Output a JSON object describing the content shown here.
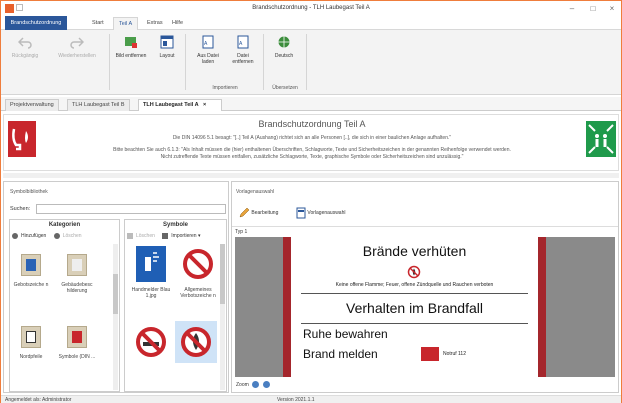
{
  "window": {
    "title": "Brandschutzordnung - TLH Laubegast Teil A",
    "controls": [
      "–",
      "□",
      "×"
    ]
  },
  "ribbon_tabs": [
    "Brandschutzordnung",
    "Start",
    "Teil A",
    "Extras",
    "Hilfe"
  ],
  "ribbon": {
    "back_label": "Rückgängig",
    "forward_label": "Wiederherstellen",
    "bild_label": "Bild entfernen",
    "layout_label": "Layout",
    "aus_datei_label": "Aus Datei laden",
    "datei_entfernen_label": "Datei entfernen",
    "deutsch_label": "Deutsch",
    "group_importieren": "Importieren",
    "group_uebersetzen": "Übersetzen"
  },
  "doc_tabs": [
    "Projektverwaltung",
    "TLH Laubegast Teil B",
    "TLH Laubegast Teil A"
  ],
  "doc_tab_close": "×",
  "header": {
    "title": "Brandschutzordnung Teil A",
    "line1": "Die DIN 14096 5.1 besagt: \"[..] Teil A (Aushang) richtet sich an alle Personen [..], die sich in einer baulichen Anlage aufhalten.\"",
    "line2": "Bitte beachten Sie auch 6.1.3: \"Als Inhalt müssen die (hier) enthaltenen Überschriften, Schlagworte, Texte und Sicherheitszeichen in der genannten Reihenfolge verwendet werden.",
    "line3": "Nicht zutreffende Texte müssen entfallen, zusätzliche Schlagworte, Texte, graphische Symbole oder Sicherheitszeichen sind unzulässig.\""
  },
  "left_panel": {
    "title": "Symbolbibliothek",
    "search_label": "Suchen:",
    "search_value": "",
    "categories_header": "Kategorien",
    "cat_add": "Hinzufügen",
    "cat_delete": "Löschen",
    "categories": [
      {
        "name": "Gebotszeiche n",
        "icon": "mandatory-sign-icon"
      },
      {
        "name": "Gebäudebesc hilderung",
        "icon": "building-sign-icon"
      },
      {
        "name": "Nordpfeile",
        "icon": "north-arrow-icon"
      },
      {
        "name": "Symbole (DIN ...",
        "icon": "din-symbol-icon"
      }
    ],
    "symbols_header": "Symbole",
    "sym_delete": "Löschen",
    "sym_import": "Importieren ▾",
    "symbols": [
      {
        "name": "Handmelder Blau 1.jpg",
        "icon": "manual-call-point-icon"
      },
      {
        "name": "Allgemeines Verbotszeiche n",
        "icon": "prohibition-sign-icon"
      },
      {
        "name": "",
        "icon": "no-smoking-icon"
      },
      {
        "name": "",
        "icon": "no-fire-icon"
      }
    ]
  },
  "right_panel": {
    "title": "Vorlagenauswahl",
    "edit_label": "Bearbeitung",
    "template_label": "Vorlagenauswahl",
    "typ_label": "Typ 1",
    "zoom_label": "Zoom",
    "preview": {
      "title1": "Brände verhüten",
      "sub": "Keine offene Flamme; Feuer, offene Zündquelle und Rauchen verboten",
      "title2": "Verhalten im Brandfall",
      "line3": "Ruhe bewahren",
      "line4": "Brand melden",
      "notruf": "Notruf 112"
    }
  },
  "status": {
    "user": "Angemeldet als: Administrator",
    "version": "Version 2021.1.1"
  },
  "colors": {
    "accent": "#2b579a",
    "window_border": "#ef7d3c",
    "fire_red": "#c8262c",
    "escape_green": "#1f9a4b",
    "page_border": "#a4262c"
  }
}
